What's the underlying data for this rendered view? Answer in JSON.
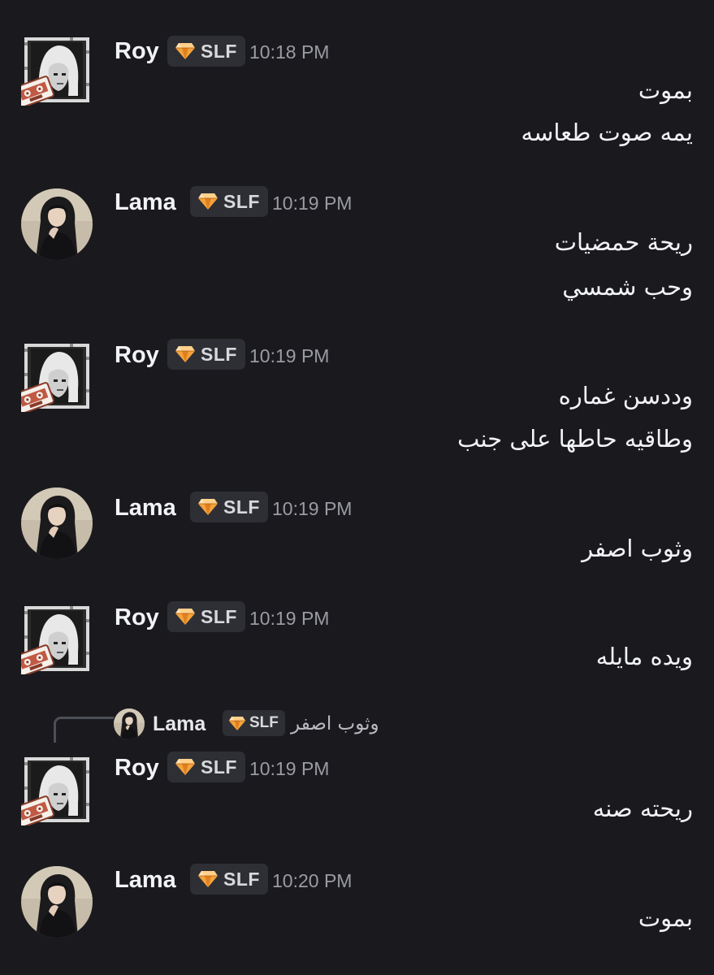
{
  "messages": [
    {
      "author": "Roy",
      "tag": "SLF",
      "time": "10:18 PM",
      "avatar_icon": "roy-pixel-avatar-icon",
      "lines": [
        "بموت",
        "يمه صوت طعاسه"
      ]
    },
    {
      "author": "Lama",
      "tag": "SLF",
      "time": "10:19 PM",
      "avatar_icon": "lama-avatar-icon",
      "lines": [
        "ريحة حمضيات",
        "وحب شمسي"
      ]
    },
    {
      "author": "Roy",
      "tag": "SLF",
      "time": "10:19 PM",
      "avatar_icon": "roy-pixel-avatar-icon",
      "lines": [
        "وددسن غماره",
        "وطاقيه حاطها على جنب"
      ]
    },
    {
      "author": "Lama",
      "tag": "SLF",
      "time": "10:19 PM",
      "avatar_icon": "lama-avatar-icon",
      "lines": [
        "وثوب اصفر"
      ]
    },
    {
      "author": "Roy",
      "tag": "SLF",
      "time": "10:19 PM",
      "avatar_icon": "roy-pixel-avatar-icon",
      "lines": [
        "ويده مايله"
      ]
    },
    {
      "author": "Roy",
      "tag": "SLF",
      "time": "10:19 PM",
      "avatar_icon": "roy-pixel-avatar-icon",
      "reply": {
        "author": "Lama",
        "tag": "SLF",
        "text": "وثوب اصفر"
      },
      "lines": [
        "ريحته صنه"
      ]
    },
    {
      "author": "Lama",
      "tag": "SLF",
      "time": "10:20 PM",
      "avatar_icon": "lama-avatar-icon",
      "lines": [
        "بموت"
      ]
    }
  ],
  "colors": {
    "background": "#1a1a1e",
    "tag_background": "#2e2f35",
    "timestamp": "#9a9ba3",
    "gem": "#f0a23a",
    "text": "#f2f3f5"
  }
}
